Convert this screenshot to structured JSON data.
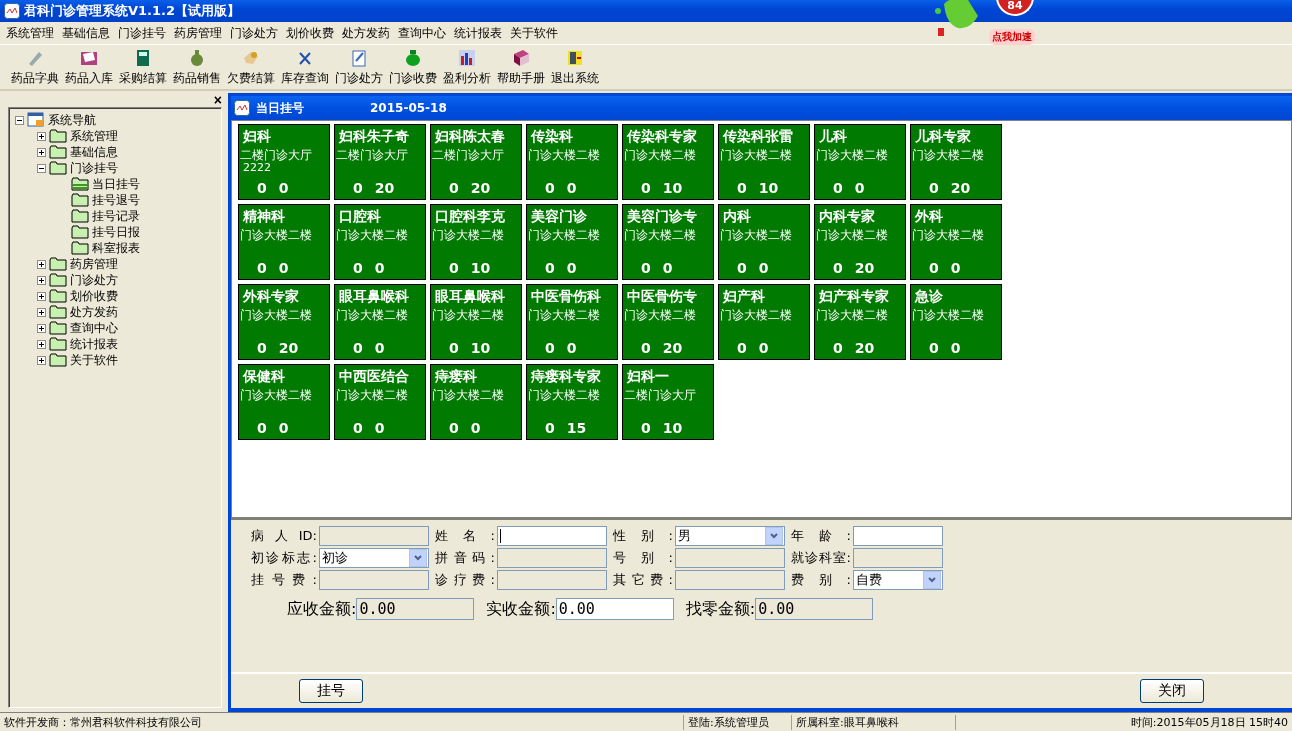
{
  "window": {
    "title": "君科门诊管理系统V1.1.2【试用版】"
  },
  "speed_widget": {
    "badge": "84",
    "label": "点我加速"
  },
  "menu": [
    "系统管理",
    "基础信息",
    "门诊挂号",
    "药房管理",
    "门诊处方",
    "划价收费",
    "处方发药",
    "查询中心",
    "统计报表",
    "关于软件"
  ],
  "toolbar": [
    "药品字典",
    "药品入库",
    "采购结算",
    "药品销售",
    "欠费结算",
    "库存查询",
    "门诊处方",
    "门诊收费",
    "盈利分析",
    "帮助手册",
    "退出系统"
  ],
  "sidebar": {
    "close": "×",
    "root": {
      "label": "系统导航",
      "expanded": true,
      "children": [
        {
          "label": "系统管理",
          "expanded": false
        },
        {
          "label": "基础信息",
          "expanded": false
        },
        {
          "label": "门诊挂号",
          "expanded": true,
          "children": [
            {
              "label": "当日挂号",
              "selected": true
            },
            {
              "label": "挂号退号",
              "selected": false
            },
            {
              "label": "挂号记录",
              "selected": false
            },
            {
              "label": "挂号日报",
              "selected": false
            },
            {
              "label": "科室报表",
              "selected": false
            }
          ]
        },
        {
          "label": "药房管理",
          "expanded": false
        },
        {
          "label": "门诊处方",
          "expanded": false
        },
        {
          "label": "划价收费",
          "expanded": false
        },
        {
          "label": "处方发药",
          "expanded": false
        },
        {
          "label": "查询中心",
          "expanded": false
        },
        {
          "label": "统计报表",
          "expanded": false
        },
        {
          "label": "关于软件",
          "expanded": false
        }
      ]
    }
  },
  "child_window": {
    "title": "当日挂号",
    "date": "2015-05-18"
  },
  "departments": [
    {
      "name": "妇科",
      "location": "二楼门诊大厅",
      "note": "2222",
      "counts": [
        "0",
        "0"
      ]
    },
    {
      "name": "妇科朱子奇",
      "location": "二楼门诊大厅",
      "counts": [
        "0",
        "20"
      ]
    },
    {
      "name": "妇科陈太春",
      "location": "二楼门诊大厅",
      "counts": [
        "0",
        "20"
      ]
    },
    {
      "name": "传染科",
      "location": "门诊大楼二楼",
      "counts": [
        "0",
        "0"
      ]
    },
    {
      "name": "传染科专家",
      "location": "门诊大楼二楼",
      "counts": [
        "0",
        "10"
      ]
    },
    {
      "name": "传染科张雷",
      "location": "门诊大楼二楼",
      "counts": [
        "0",
        "10"
      ]
    },
    {
      "name": "儿科",
      "location": "门诊大楼二楼",
      "counts": [
        "0",
        "0"
      ]
    },
    {
      "name": "儿科专家",
      "location": "门诊大楼二楼",
      "counts": [
        "0",
        "20"
      ]
    },
    {
      "name": "精神科",
      "location": "门诊大楼二楼",
      "counts": [
        "0",
        "0"
      ]
    },
    {
      "name": "口腔科",
      "location": "门诊大楼二楼",
      "counts": [
        "0",
        "0"
      ]
    },
    {
      "name": "口腔科李克",
      "location": "门诊大楼二楼",
      "counts": [
        "0",
        "10"
      ]
    },
    {
      "name": "美容门诊",
      "location": "门诊大楼二楼",
      "counts": [
        "0",
        "0"
      ]
    },
    {
      "name": "美容门诊专",
      "location": "门诊大楼二楼",
      "counts": [
        "0",
        "0"
      ]
    },
    {
      "name": "内科",
      "location": "门诊大楼二楼",
      "counts": [
        "0",
        "0"
      ]
    },
    {
      "name": "内科专家",
      "location": "门诊大楼二楼",
      "counts": [
        "0",
        "20"
      ]
    },
    {
      "name": "外科",
      "location": "门诊大楼二楼",
      "counts": [
        "0",
        "0"
      ]
    },
    {
      "name": "外科专家",
      "location": "门诊大楼二楼",
      "counts": [
        "0",
        "20"
      ]
    },
    {
      "name": "眼耳鼻喉科",
      "location": "门诊大楼二楼",
      "counts": [
        "0",
        "0"
      ]
    },
    {
      "name": "眼耳鼻喉科",
      "location": "门诊大楼二楼",
      "counts": [
        "0",
        "10"
      ]
    },
    {
      "name": "中医骨伤科",
      "location": "门诊大楼二楼",
      "counts": [
        "0",
        "0"
      ]
    },
    {
      "name": "中医骨伤专",
      "location": "门诊大楼二楼",
      "counts": [
        "0",
        "20"
      ]
    },
    {
      "name": "妇产科",
      "location": "门诊大楼二楼",
      "counts": [
        "0",
        "0"
      ]
    },
    {
      "name": "妇产科专家",
      "location": "门诊大楼二楼",
      "counts": [
        "0",
        "20"
      ]
    },
    {
      "name": "急诊",
      "location": "门诊大楼二楼",
      "counts": [
        "0",
        "0"
      ]
    },
    {
      "name": "保健科",
      "location": "门诊大楼二楼",
      "counts": [
        "0",
        "0"
      ]
    },
    {
      "name": "中西医结合",
      "location": "门诊大楼二楼",
      "counts": [
        "0",
        "0"
      ]
    },
    {
      "name": "痔瘘科",
      "location": "门诊大楼二楼",
      "counts": [
        "0",
        "0"
      ]
    },
    {
      "name": "痔瘘科专家",
      "location": "门诊大楼二楼",
      "counts": [
        "0",
        "15"
      ]
    },
    {
      "name": "妇科一",
      "location": "二楼门诊大厅",
      "counts": [
        "0",
        "10"
      ]
    }
  ],
  "form": {
    "fields": [
      {
        "label": "病人ID:",
        "kind": "text",
        "disabled": true
      },
      {
        "label": "姓名:",
        "kind": "text",
        "disabled": false
      },
      {
        "label": "性别:",
        "kind": "select",
        "value": "男",
        "disabled": false
      },
      {
        "label": "年龄:",
        "kind": "text",
        "disabled": false
      },
      {
        "label": "初诊标志:",
        "kind": "select",
        "value": "初诊",
        "disabled": false
      },
      {
        "label": "拼音码:",
        "kind": "text",
        "disabled": true
      },
      {
        "label": "号别:",
        "kind": "text",
        "disabled": true
      },
      {
        "label": "就诊科室:",
        "kind": "text",
        "disabled": true
      },
      {
        "label": "挂号费:",
        "kind": "text",
        "disabled": true
      },
      {
        "label": "诊疗费:",
        "kind": "text",
        "disabled": true
      },
      {
        "label": "其它费:",
        "kind": "text",
        "disabled": true
      },
      {
        "label": "费别:",
        "kind": "select",
        "value": "自费",
        "disabled": false
      }
    ],
    "amounts": [
      {
        "label": "应收金额:",
        "value": "0.00",
        "disabled": true
      },
      {
        "label": "实收金额:",
        "value": "0.00",
        "disabled": false
      },
      {
        "label": "找零金额:",
        "value": "0.00",
        "disabled": true
      }
    ]
  },
  "buttons": [
    "挂号",
    "关闭"
  ],
  "status_bar": [
    "软件开发商：常州君科软件科技有限公司",
    "登陆:系统管理员",
    "所属科室:眼耳鼻喉科",
    "时间:2015年05月18日  15时40"
  ]
}
